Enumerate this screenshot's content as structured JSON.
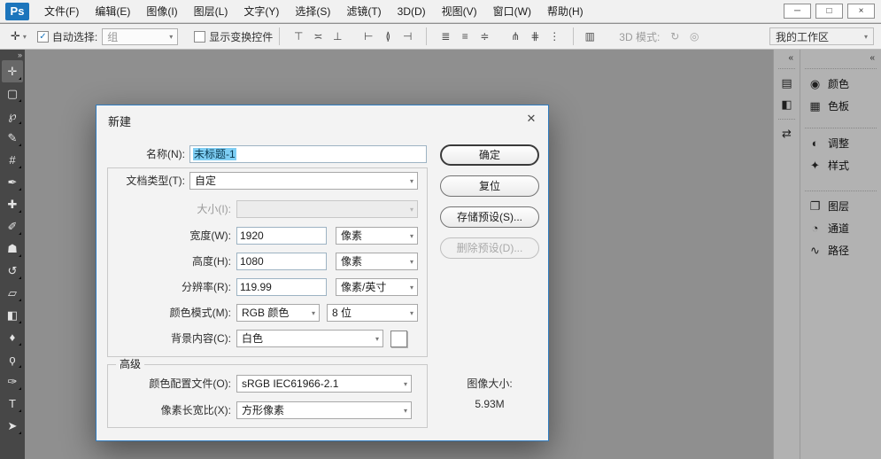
{
  "ui": {
    "chevron": "▾",
    "check": "✓",
    "collapse_right": "»",
    "collapse_left": "«"
  },
  "colors": {
    "accent_blue": "#1c75bc",
    "dialog_border": "#2f7bbf",
    "selection_bg": "#7ecef4",
    "canvas_gray": "#8f8f8f",
    "toolbar_dark": "#474747",
    "panel_gray": "#b2b2b2"
  },
  "menubar": {
    "logo": "Ps",
    "items": [
      "文件(F)",
      "编辑(E)",
      "图像(I)",
      "图层(L)",
      "文字(Y)",
      "选择(S)",
      "滤镜(T)",
      "3D(D)",
      "视图(V)",
      "窗口(W)",
      "帮助(H)"
    ],
    "window": {
      "minimize": "─",
      "maximize": "□",
      "close": "×"
    }
  },
  "options": {
    "tool_icon": "✛",
    "auto_select": {
      "label": "自动选择:",
      "checked": true,
      "value": "组"
    },
    "show_transform": {
      "label": "显示变换控件",
      "checked": false
    },
    "align_icons": [
      "⊤",
      "≍",
      "⊥",
      "⊢",
      "≬",
      "⊣",
      "≣",
      "≡",
      "≑",
      "⋔",
      "⋕",
      "⋮"
    ],
    "auto_align_icon": "▥",
    "mode3d": {
      "label": "3D 模式:",
      "icons": [
        "↻",
        "◎"
      ]
    },
    "workspace": "我的工作区"
  },
  "toolbar": {
    "tools": [
      {
        "name": "move",
        "glyph": "✛",
        "selected": true
      },
      {
        "name": "rectangular-marquee",
        "glyph": "▢"
      },
      {
        "name": "lasso",
        "glyph": "℘"
      },
      {
        "name": "quick-selection",
        "glyph": "✎"
      },
      {
        "name": "crop",
        "glyph": "#"
      },
      {
        "name": "eyedropper",
        "glyph": "✒"
      },
      {
        "name": "healing-brush",
        "glyph": "✚"
      },
      {
        "name": "brush",
        "glyph": "✐"
      },
      {
        "name": "clone-stamp",
        "glyph": "☗"
      },
      {
        "name": "history-brush",
        "glyph": "↺"
      },
      {
        "name": "eraser",
        "glyph": "▱"
      },
      {
        "name": "gradient",
        "glyph": "◧"
      },
      {
        "name": "blur",
        "glyph": "♦"
      },
      {
        "name": "dodge",
        "glyph": "ϙ"
      },
      {
        "name": "pen",
        "glyph": "✑"
      },
      {
        "name": "type",
        "glyph": "T"
      },
      {
        "name": "path-selection",
        "glyph": "➤"
      }
    ]
  },
  "dialog": {
    "title": "新建",
    "close_icon": "✕",
    "name": {
      "label": "名称(N):",
      "value": "未标题-1"
    },
    "doc_type": {
      "label": "文档类型(T):",
      "value": "自定"
    },
    "size": {
      "label": "大小(I):",
      "value": ""
    },
    "width": {
      "label": "宽度(W):",
      "value": "1920",
      "unit": "像素"
    },
    "height": {
      "label": "高度(H):",
      "value": "1080",
      "unit": "像素"
    },
    "resolution": {
      "label": "分辨率(R):",
      "value": "119.99",
      "unit": "像素/英寸"
    },
    "color_mode": {
      "label": "颜色模式(M):",
      "value": "RGB 颜色",
      "depth": "8 位"
    },
    "background": {
      "label": "背景内容(C):",
      "value": "白色",
      "swatch_color": "#ffffff"
    },
    "advanced": {
      "label": "高级",
      "profile": {
        "label": "颜色配置文件(O):",
        "value": "sRGB IEC61966-2.1"
      },
      "aspect": {
        "label": "像素长宽比(X):",
        "value": "方形像素"
      }
    },
    "buttons": {
      "ok": "确定",
      "reset": "复位",
      "save_preset": "存储预设(S)...",
      "delete_preset": "删除预设(D)..."
    },
    "image_size": {
      "label": "图像大小:",
      "value": "5.93M"
    }
  },
  "panels": {
    "mini_icons": [
      {
        "name": "history",
        "glyph": "▤"
      },
      {
        "name": "properties",
        "glyph": "◧"
      },
      {
        "name": "info",
        "glyph": "⇄"
      }
    ],
    "tabs": [
      {
        "name": "color",
        "glyph": "◉",
        "label": "颜色"
      },
      {
        "name": "swatches",
        "glyph": "▦",
        "label": "色板"
      },
      {
        "name": "adjustments",
        "glyph": "◐",
        "label": "调整"
      },
      {
        "name": "styles",
        "glyph": "✦",
        "label": "样式"
      },
      {
        "name": "layers",
        "glyph": "❐",
        "label": "图层"
      },
      {
        "name": "channels",
        "glyph": "◔",
        "label": "通道"
      },
      {
        "name": "paths",
        "glyph": "∿",
        "label": "路径"
      }
    ]
  }
}
